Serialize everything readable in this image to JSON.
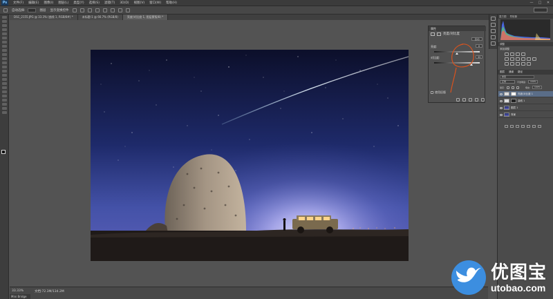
{
  "menubar": {
    "logo": "Ps",
    "items": [
      "文件(F)",
      "编辑(E)",
      "图像(I)",
      "图层(L)",
      "类型(Y)",
      "选择(S)",
      "滤镜(T)",
      "3D(D)",
      "视图(V)",
      "窗口(W)",
      "帮助(H)"
    ],
    "controls": [
      "—",
      "□",
      "✕"
    ]
  },
  "optionsbar": {
    "auto_select": "自动选择:",
    "layer_option": "图层",
    "show_transform": "显示变换控件"
  },
  "tabs": [
    {
      "label": "DSC_2155.JPG @ 33.3% (曲线 1, RGB/8#) *",
      "active": false
    },
    {
      "label": "未标题-1 @ 66.7% (RGB/8)",
      "active": false
    },
    {
      "label": "亮度/对比度 1, 图层蒙版/8) *",
      "active": true
    }
  ],
  "properties": {
    "header": "属性",
    "title": "亮度/对比度",
    "preset": "自动",
    "brightness_label": "亮度:",
    "brightness_value": "0",
    "contrast_label": "对比度:",
    "contrast_value": "33",
    "legacy_label": "使用旧版"
  },
  "histogram_tabs": [
    "直方图",
    "导航器"
  ],
  "adjustments": {
    "tab": "调整",
    "title": "添加调整"
  },
  "layers": {
    "tabs": [
      "图层",
      "通道",
      "路径"
    ],
    "filter": "类型",
    "blend_mode": "正常",
    "opacity_label": "不透明度:",
    "opacity_value": "100%",
    "lock_label": "锁定:",
    "fill_label": "填充:",
    "fill_value": "100%",
    "items": [
      {
        "name": "亮度/对比度 1",
        "selected": true
      },
      {
        "name": "曲线 1",
        "selected": false
      },
      {
        "name": "图层 1",
        "selected": false
      },
      {
        "name": "背景",
        "selected": false
      }
    ]
  },
  "status": {
    "zoom": "33.33%",
    "doc_info": "文档:72.3M/134.2M",
    "tab": "Mini Bridge"
  },
  "watermark": {
    "text": "优图宝",
    "url": "utobao.com"
  },
  "colors": {
    "accent": "#3c8ee0",
    "annotation": "#d9531e",
    "sky_top": "#0c0f2a",
    "sky_horizon": "#c9c5ff"
  }
}
